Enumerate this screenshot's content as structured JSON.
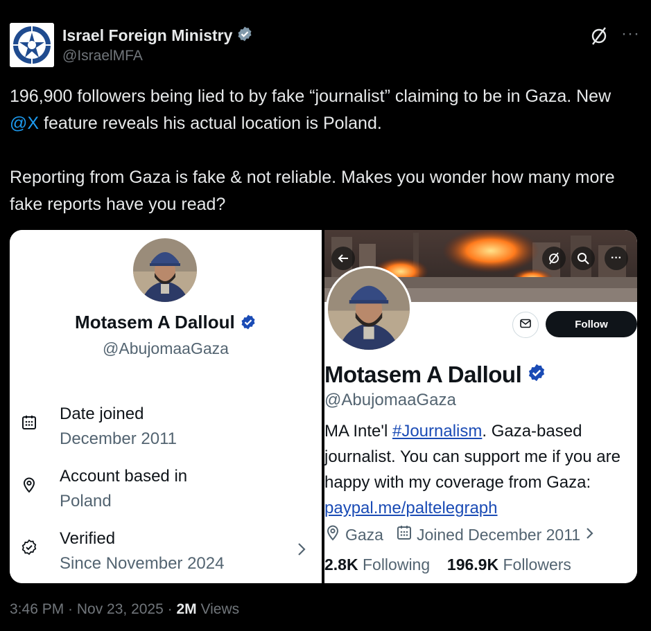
{
  "tweet": {
    "author": {
      "display_name": "Israel Foreign Ministry",
      "handle": "@IsraelMFA"
    },
    "text_part1": "196,900 followers being lied to by fake “journalist” claiming to be in Gaza. New ",
    "mention": "@X",
    "text_part2": " feature reveals his actual location is Poland.\n\nReporting from Gaza is fake & not reliable. Makes you wonder how many more fake reports have you read?",
    "timestamp": "3:46 PM · Nov 23, 2025 · ",
    "views_count": "2M",
    "views_label": " Views"
  },
  "left_card": {
    "name": "Motasem A Dalloul",
    "handle": "@AbujomaaGaza",
    "rows": [
      {
        "label": "Date joined",
        "value": "December 2011",
        "icon": "calendar-icon"
      },
      {
        "label": "Account based in",
        "value": "Poland",
        "icon": "location-pin-icon"
      },
      {
        "label": "Verified",
        "value": "Since November 2024",
        "icon": "verified-badge-icon"
      }
    ]
  },
  "right_card": {
    "name": "Motasem A Dalloul",
    "handle": "@AbujomaaGaza",
    "follow_label": "Follow",
    "bio_part1": "MA Inte'l ",
    "bio_hashtag": "#Journalism",
    "bio_part2": ". Gaza-based journalist. You can support me if you are happy with my coverage from Gaza: ",
    "bio_link": "paypal.me/paltelegraph",
    "location": "Gaza",
    "joined": "Joined December 2011",
    "following_count": "2.8K",
    "following_label": " Following",
    "followers_count": "196.9K",
    "followers_label": " Followers"
  },
  "colors": {
    "background": "#000000",
    "text_primary": "#e7e9ea",
    "text_secondary": "#71767b",
    "accent": "#1d9bf0",
    "verified_blue": "#1d9bf0",
    "card_verified_blue": "#1a4bb5"
  }
}
